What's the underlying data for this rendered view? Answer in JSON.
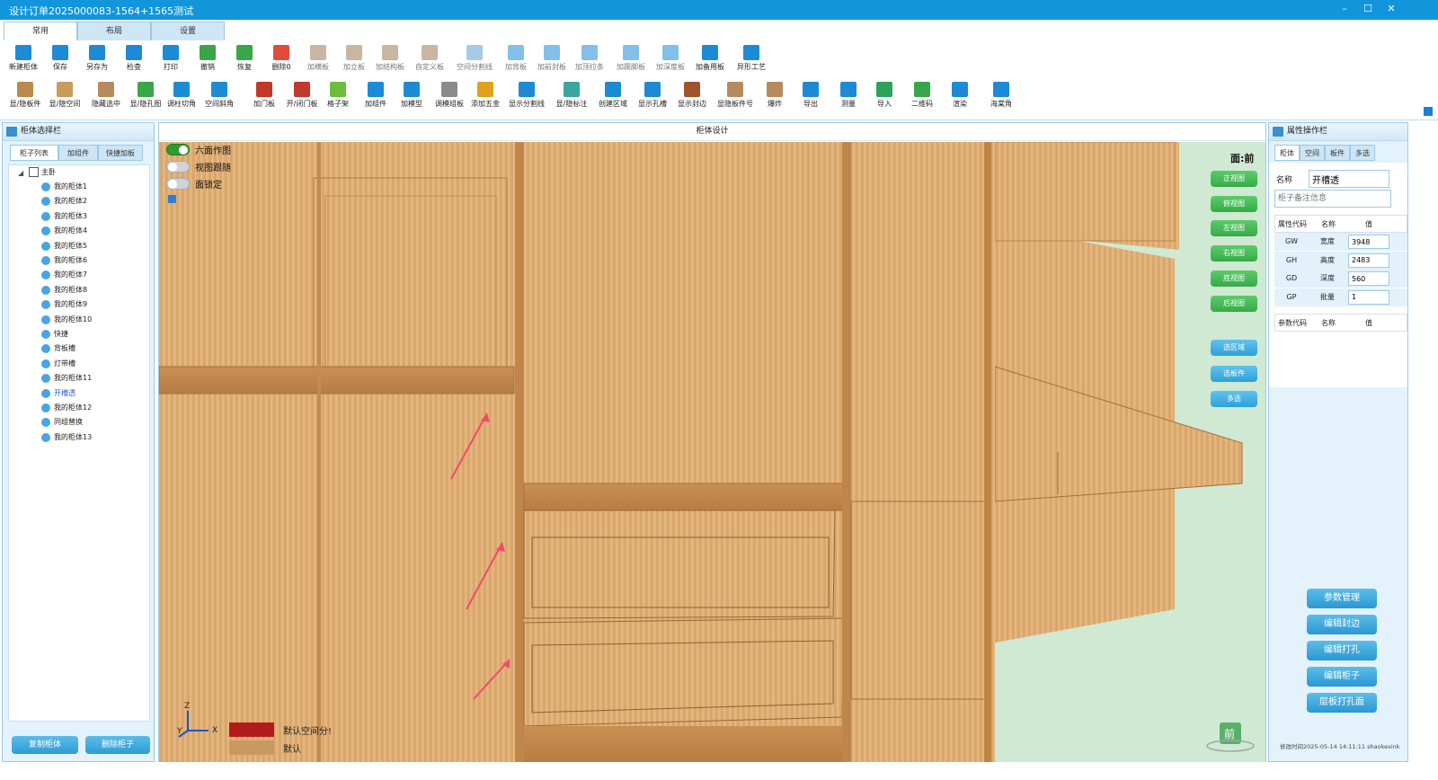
{
  "window": {
    "title": "设计订单2025000083-1564+1565测试",
    "min": "–",
    "max": "☐",
    "close": "✕"
  },
  "ribbon_tabs": [
    "常用",
    "布局",
    "设置"
  ],
  "toolbar_row1": [
    {
      "label": "新建柜体",
      "icon": "new-cabinet-icon",
      "color": "#1d8ad6"
    },
    {
      "label": "保存",
      "icon": "save-icon",
      "color": "#1d8ad6"
    },
    {
      "label": "另存为",
      "icon": "save-as-icon",
      "color": "#1d8ad6"
    },
    {
      "label": "检查",
      "icon": "check-icon",
      "color": "#1d8ad6"
    },
    {
      "label": "打印",
      "icon": "print-icon",
      "color": "#1d8ad6"
    },
    {
      "label": "撤销",
      "icon": "undo-icon",
      "color": "#3aa64a"
    },
    {
      "label": "恢复",
      "icon": "redo-icon",
      "color": "#3aa64a"
    },
    {
      "label": "删除0",
      "icon": "delete-icon",
      "color": "#e24b3b"
    },
    {
      "label": "加横板",
      "icon": "add-horizontal-board-icon",
      "color": "#9a7a55",
      "dim": true
    },
    {
      "label": "加立板",
      "icon": "add-vertical-board-icon",
      "color": "#9a7a55",
      "dim": true
    },
    {
      "label": "加结构板",
      "icon": "add-structure-board-icon",
      "color": "#9a7a55",
      "dim": true
    },
    {
      "label": "自定义板",
      "icon": "custom-board-icon",
      "color": "#9a7a55",
      "dim": true
    },
    {
      "label": "空间分割线",
      "icon": "space-divider-icon",
      "color": "#5aa0d8",
      "dim": true
    },
    {
      "label": "加背板",
      "icon": "add-back-board-icon",
      "color": "#1d8ad6",
      "dim": true
    },
    {
      "label": "加前封板",
      "icon": "add-front-seal-icon",
      "color": "#1d8ad6",
      "dim": true
    },
    {
      "label": "加顶拉条",
      "icon": "add-top-strip-icon",
      "color": "#1d8ad6",
      "dim": true
    },
    {
      "label": "加踢脚板",
      "icon": "add-kickboard-icon",
      "color": "#1d8ad6",
      "dim": true
    },
    {
      "label": "加深度板",
      "icon": "add-depth-board-icon",
      "color": "#1d8ad6",
      "dim": true
    },
    {
      "label": "加备用板",
      "icon": "add-spare-board-icon",
      "color": "#1d8ad6"
    },
    {
      "label": "异形工艺",
      "icon": "special-process-icon",
      "color": "#1d8ad6"
    }
  ],
  "toolbar_row2": [
    {
      "label": "显/隐板件",
      "icon": "toggle-boards-icon",
      "color": "#b88a4c"
    },
    {
      "label": "显/隐空间",
      "icon": "toggle-space-icon",
      "color": "#c99a5c"
    },
    {
      "label": "隐藏选中",
      "icon": "hide-selected-icon",
      "color": "#b58b5e"
    },
    {
      "label": "显/隐孔图",
      "icon": "toggle-holes-icon",
      "color": "#3aa64a"
    },
    {
      "label": "调柱切角",
      "icon": "column-cut-icon",
      "color": "#1d8ad6"
    },
    {
      "label": "空间斜角",
      "icon": "space-bevel-icon",
      "color": "#1d8ad6"
    },
    {
      "label": "加门板",
      "icon": "add-door-icon",
      "color": "#c0392b"
    },
    {
      "label": "开/闭门板",
      "icon": "open-close-door-icon",
      "color": "#c0392b"
    },
    {
      "label": "格子架",
      "icon": "grid-rack-icon",
      "color": "#6abf3a"
    },
    {
      "label": "加组件",
      "icon": "add-component-icon",
      "color": "#1d8ad6"
    },
    {
      "label": "加模型",
      "icon": "add-model-icon",
      "color": "#1d8ad6"
    },
    {
      "label": "调模组板",
      "icon": "module-board-icon",
      "color": "#8a8a8a"
    },
    {
      "label": "添加五金",
      "icon": "add-hardware-icon",
      "color": "#e0a020"
    },
    {
      "label": "显示分割线",
      "icon": "show-divider-icon",
      "color": "#1d8ad6"
    },
    {
      "label": "显/隐标注",
      "icon": "toggle-dimension-icon",
      "color": "#3aa6a0"
    },
    {
      "label": "创建区域",
      "icon": "create-area-icon",
      "color": "#1d8ad6"
    },
    {
      "label": "显示孔槽",
      "icon": "show-slots-icon",
      "color": "#1d8ad6"
    },
    {
      "label": "显示封边",
      "icon": "show-edging-icon",
      "color": "#a0522d"
    },
    {
      "label": "显隐板件号",
      "icon": "board-number-icon",
      "color": "#b58b5e"
    },
    {
      "label": "爆炸",
      "icon": "explode-icon",
      "color": "#b58b5e"
    },
    {
      "label": "导出",
      "icon": "export-icon",
      "color": "#1d8ad6"
    },
    {
      "label": "测量",
      "icon": "measure-icon",
      "color": "#1d8ad6"
    },
    {
      "label": "导入",
      "icon": "import-icon",
      "color": "#2aa45a"
    },
    {
      "label": "二维码",
      "icon": "qr-cloud-icon",
      "color": "#3aa64a"
    },
    {
      "label": "渲染",
      "icon": "render-icon",
      "color": "#1d8ad6"
    },
    {
      "label": "海棠角",
      "icon": "crabapple-corner-icon",
      "color": "#1d8ad6"
    }
  ],
  "left_panel": {
    "title": "柜体选择栏",
    "tabs": [
      "柜子列表",
      "加组件",
      "快捷加板"
    ],
    "root": "主卧",
    "items": [
      "我的柜体1",
      "我的柜体2",
      "我的柜体3",
      "我的柜体4",
      "我的柜体5",
      "我的柜体6",
      "我的柜体7",
      "我的柜体8",
      "我的柜体9",
      "我的柜体10",
      "快捷",
      "背板槽",
      "灯带槽",
      "我的柜体11",
      "开槽透",
      "我的柜体12",
      "同组替换",
      "我的柜体13"
    ],
    "selected_index": 14,
    "buttons": [
      "复制柜体",
      "删除柜子"
    ]
  },
  "canvas": {
    "title": "柜体设计",
    "toggles": [
      {
        "label": "六面作图",
        "on": true
      },
      {
        "label": "视图跟随",
        "on": false
      },
      {
        "label": "面锁定",
        "on": false
      }
    ],
    "view_label": "面:前",
    "view_buttons": [
      "正视图",
      "俯视图",
      "左视图",
      "右视图",
      "底视图",
      "后视图"
    ],
    "select_buttons": [
      "选区域",
      "选板件",
      "多选"
    ],
    "axes": {
      "z": "Z",
      "y": "Y",
      "x": "X"
    },
    "legend": [
      {
        "label": "默认空间分!",
        "color": "#b31b1b"
      },
      {
        "label": "默认",
        "color": "#c89a62"
      }
    ],
    "cube_label": "前"
  },
  "right_panel": {
    "title": "属性操作栏",
    "tabs": [
      "柜体",
      "空间",
      "板件",
      "多选"
    ],
    "name_label": "名称",
    "name_value": "开槽透",
    "note_placeholder": "柜子备注信息",
    "attr_header": [
      "属性代码",
      "名称",
      "值"
    ],
    "attrs": [
      {
        "code": "GW",
        "name": "宽度",
        "value": "3948"
      },
      {
        "code": "GH",
        "name": "高度",
        "value": "2483"
      },
      {
        "code": "GD",
        "name": "深度",
        "value": "560"
      },
      {
        "code": "GP",
        "name": "批量",
        "value": "1"
      }
    ],
    "param_header": [
      "参数代码",
      "名称",
      "值"
    ],
    "buttons": [
      "参数管理",
      "编辑封边",
      "编辑打孔",
      "编辑柜子",
      "层板打孔面"
    ],
    "footer": "修改时间2025-05-14 14:11:11 shaokexink"
  }
}
